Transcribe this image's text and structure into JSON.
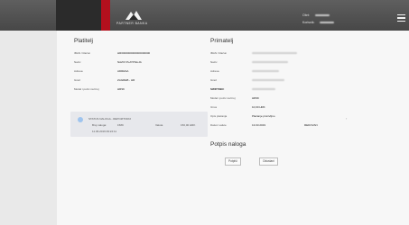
{
  "header": {
    "brand": "PARTNER BANKA",
    "line1_label": "Obrt:",
    "line2_label": "Korisnik:"
  },
  "payer": {
    "title": "Platitelj",
    "rows": [
      {
        "label": "IBAN / Račun",
        "value": "HR0000000000000000000"
      },
      {
        "label": "Naziv",
        "value": "NAZIV PLATITELJA"
      },
      {
        "label": "Adresa",
        "value": "ADRESA"
      },
      {
        "label": "Grad",
        "value": "ZAGREB - HR"
      },
      {
        "label": "Model i poziv na broj",
        "value": "HR99"
      }
    ]
  },
  "status": {
    "title": "STATUS NALOGA - REPOZITORIJ",
    "number_label": "Broj naloga:",
    "number_value": "1589",
    "amount_label": "Valuta",
    "amount_value": "150,00 HRK",
    "date": "11.06.2019 09:22:11"
  },
  "recipient": {
    "title": "Primatelj",
    "rows": [
      {
        "label": "IBAN / Račun",
        "value": ""
      },
      {
        "label": "Naziv",
        "value": ""
      },
      {
        "label": "Adresa",
        "value": ""
      },
      {
        "label": "Grad",
        "value": ""
      },
      {
        "label": "SWIFT/BIC",
        "value": ""
      },
      {
        "label": "Model i poziv na broj",
        "value": "HR99"
      },
      {
        "label": "Iznos",
        "value": "10,00 HRK"
      },
      {
        "label": "Opis plaćanja",
        "value": "Plaćanje proizvljivo"
      },
      {
        "label": "Datum valute",
        "value": "13.03.2019",
        "extra": "REDOVAN"
      }
    ]
  },
  "signature": {
    "title": "Potpis naloga",
    "sign_label": "Potpiši",
    "cancel_label": "Odustani"
  }
}
